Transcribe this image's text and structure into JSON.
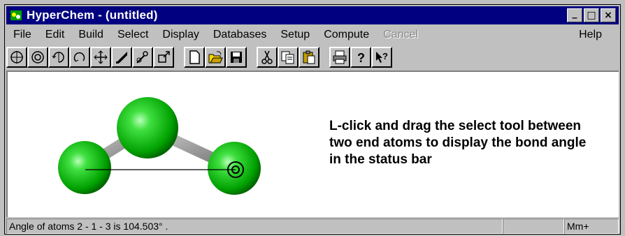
{
  "window": {
    "title": "HyperChem - (untitled)",
    "minimize_glyph": "_",
    "maximize_glyph": "□",
    "close_glyph": "×"
  },
  "menu": [
    {
      "label": "File",
      "enabled": true
    },
    {
      "label": "Edit",
      "enabled": true
    },
    {
      "label": "Build",
      "enabled": true
    },
    {
      "label": "Select",
      "enabled": true
    },
    {
      "label": "Display",
      "enabled": true
    },
    {
      "label": "Databases",
      "enabled": true
    },
    {
      "label": "Setup",
      "enabled": true
    },
    {
      "label": "Compute",
      "enabled": true
    },
    {
      "label": "Cancel",
      "enabled": false
    },
    {
      "label": "Help",
      "enabled": true
    }
  ],
  "toolbar": {
    "tools": [
      "select-tool-icon",
      "select-sphere-icon",
      "rotate-xy-icon",
      "rotate-z-icon",
      "translate-icon",
      "draw-icon",
      "magnify-icon",
      "zoom-icon"
    ],
    "file_tools": [
      "new-file-icon",
      "open-file-icon",
      "save-file-icon"
    ],
    "edit_tools": [
      "cut-icon",
      "copy-icon",
      "paste-icon"
    ],
    "help_tools": [
      "print-icon",
      "help-icon",
      "context-help-icon"
    ]
  },
  "canvas": {
    "instruction": "L-click and drag the select tool between two end atoms to display the bond angle in the status bar",
    "atom_color": "#00bb00"
  },
  "status": {
    "message": "Angle of atoms  2 -  1 -  3 is 104.503° .",
    "pane2": "",
    "mode": "Mm+"
  }
}
